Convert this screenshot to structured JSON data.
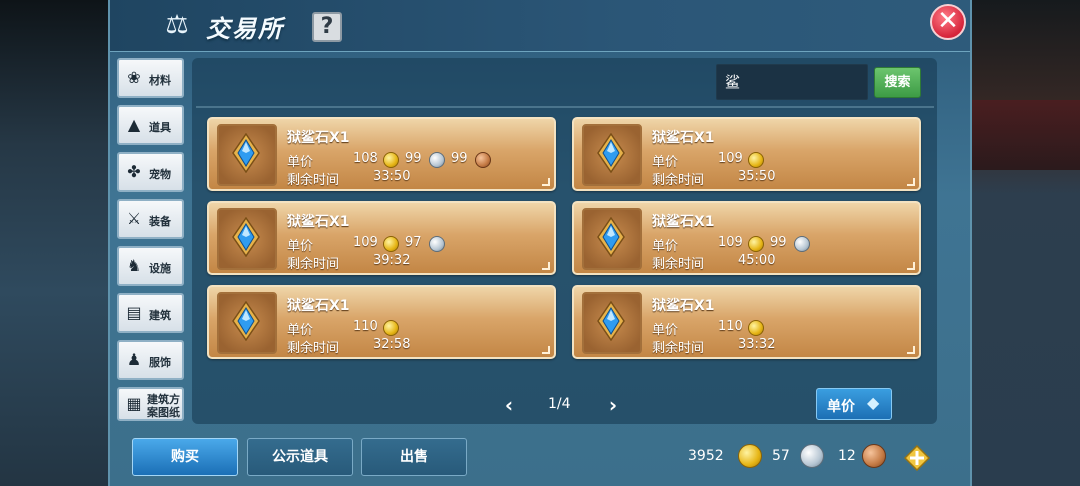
{
  "header": {
    "title": "交易所",
    "help_label": "?",
    "close_label": "✕",
    "title_icon": "scales-icon"
  },
  "categories": [
    {
      "label": "材料",
      "icon": "materials-icon"
    },
    {
      "label": "道具",
      "icon": "cone-icon"
    },
    {
      "label": "宠物",
      "icon": "paw-icon"
    },
    {
      "label": "装备",
      "icon": "sword-icon"
    },
    {
      "label": "设施",
      "icon": "horse-icon"
    },
    {
      "label": "建筑",
      "icon": "brick-wall-icon"
    },
    {
      "label": "服饰",
      "icon": "clothes-icon"
    },
    {
      "label": "建筑方案图纸",
      "icon": "blueprint-icon"
    }
  ],
  "search": {
    "value": "鲨",
    "button_label": "搜索"
  },
  "listings": [
    {
      "name": "狱鲨石X1",
      "price_label": "单价",
      "gold": "108",
      "silver": "99",
      "copper": "99",
      "time_label": "剩余时间",
      "time": "33:50"
    },
    {
      "name": "狱鲨石X1",
      "price_label": "单价",
      "gold": "109",
      "silver": "",
      "copper": "",
      "time_label": "剩余时间",
      "time": "35:50"
    },
    {
      "name": "狱鲨石X1",
      "price_label": "单价",
      "gold": "109",
      "silver": "97",
      "copper": "",
      "time_label": "剩余时间",
      "time": "39:32"
    },
    {
      "name": "狱鲨石X1",
      "price_label": "单价",
      "gold": "109",
      "silver": "99",
      "copper": "",
      "time_label": "剩余时间",
      "time": "45:00"
    },
    {
      "name": "狱鲨石X1",
      "price_label": "单价",
      "gold": "110",
      "silver": "",
      "copper": "",
      "time_label": "剩余时间",
      "time": "32:58"
    },
    {
      "name": "狱鲨石X1",
      "price_label": "单价",
      "gold": "110",
      "silver": "",
      "copper": "",
      "time_label": "剩余时间",
      "time": "33:32"
    }
  ],
  "pagination": {
    "prev": "‹",
    "next": "›",
    "text": "1/4"
  },
  "sort": {
    "label": "单价"
  },
  "tabs": [
    {
      "label": "购买",
      "active": true
    },
    {
      "label": "公示道具",
      "active": false
    },
    {
      "label": "出售",
      "active": false
    }
  ],
  "currency": {
    "gold": "3952",
    "silver": "57",
    "copper": "12"
  },
  "colors": {
    "panel": "#3f7493",
    "card": "#d9a569",
    "search_button": "#4fae55",
    "active_tab": "#2b8ad0",
    "close_button": "#d6243a"
  }
}
